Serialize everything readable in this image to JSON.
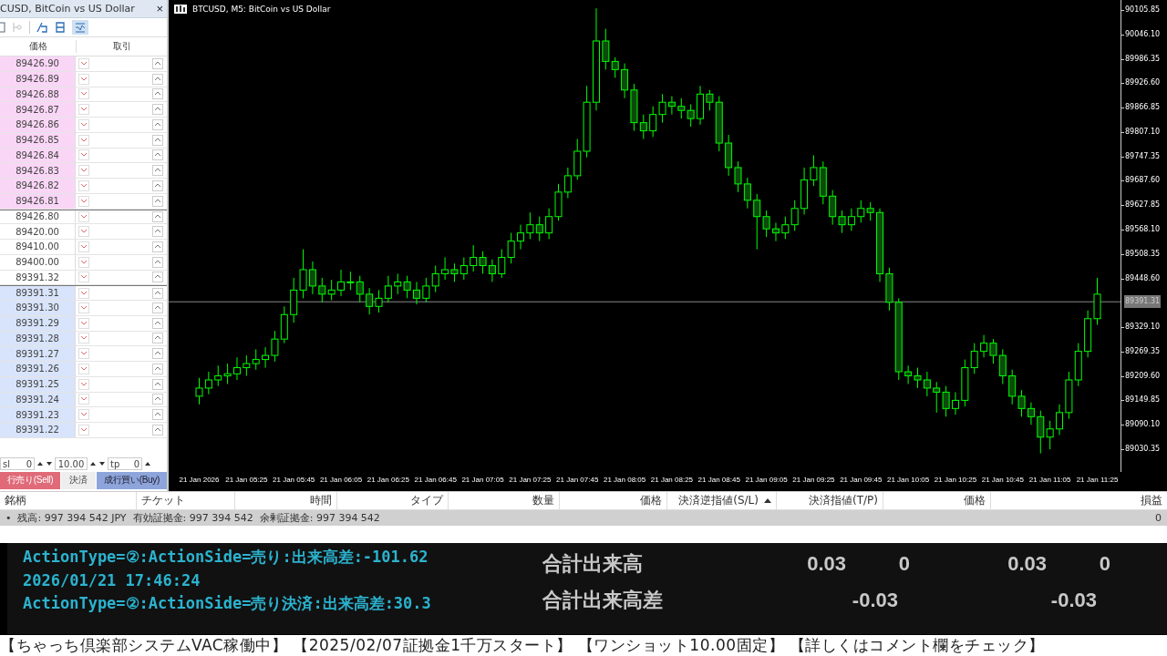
{
  "panel": {
    "title": "CUSD, BitCoin vs US Dollar",
    "close": "×",
    "headers": [
      "価格",
      "取引"
    ],
    "rows": [
      {
        "price": "89426.90",
        "kind": "sell"
      },
      {
        "price": "89426.89",
        "kind": "sell"
      },
      {
        "price": "89426.88",
        "kind": "sell"
      },
      {
        "price": "89426.87",
        "kind": "sell"
      },
      {
        "price": "89426.86",
        "kind": "sell"
      },
      {
        "price": "89426.85",
        "kind": "sell"
      },
      {
        "price": "89426.84",
        "kind": "sell"
      },
      {
        "price": "89426.83",
        "kind": "sell"
      },
      {
        "price": "89426.82",
        "kind": "sell"
      },
      {
        "price": "89426.81",
        "kind": "sell"
      },
      {
        "price": "89426.80",
        "kind": "plain"
      },
      {
        "price": "89420.00",
        "kind": "plain"
      },
      {
        "price": "89410.00",
        "kind": "plain"
      },
      {
        "price": "89400.00",
        "kind": "plain"
      },
      {
        "price": "89391.32",
        "kind": "plain"
      },
      {
        "price": "89391.31",
        "kind": "buy"
      },
      {
        "price": "89391.30",
        "kind": "buy"
      },
      {
        "price": "89391.29",
        "kind": "buy"
      },
      {
        "price": "89391.28",
        "kind": "buy"
      },
      {
        "price": "89391.27",
        "kind": "buy"
      },
      {
        "price": "89391.26",
        "kind": "buy"
      },
      {
        "price": "89391.25",
        "kind": "buy"
      },
      {
        "price": "89391.24",
        "kind": "buy"
      },
      {
        "price": "89391.23",
        "kind": "buy"
      },
      {
        "price": "89391.22",
        "kind": "buy"
      }
    ],
    "sl_label": "sl",
    "sl_value": "0",
    "volume": "10.00",
    "tp_label": "tp",
    "tp_value": "0",
    "sell_button": "行売り(Sell)",
    "close_button": "決済",
    "buy_button": "成行買い(Buy)"
  },
  "chart": {
    "title": "BTCUSD, M5: BitCoin vs US Dollar",
    "chart_data": {
      "type": "candlestick",
      "categories": [
        "21 Jan 2026",
        null,
        null,
        null,
        null,
        "21 Jan 05:25",
        null,
        null,
        null,
        null,
        "21 Jan 05:45",
        null,
        null,
        null,
        null,
        "21 Jan 06:05",
        null,
        null,
        null,
        null,
        "21 Jan 06:25",
        null,
        null,
        null,
        null,
        "21 Jan 06:45",
        null,
        null,
        null,
        null,
        "21 Jan 07:05",
        null,
        null,
        null,
        null,
        "21 Jan 07:25",
        null,
        null,
        null,
        null,
        "21 Jan 07:45",
        null,
        null,
        null,
        null,
        "21 Jan 08:05",
        null,
        null,
        null,
        null,
        "21 Jan 08:25",
        null,
        null,
        null,
        null,
        "21 Jan 08:45",
        null,
        null,
        null,
        null,
        "21 Jan 09:05",
        null,
        null,
        null,
        null,
        "21 Jan 09:25",
        null,
        null,
        null,
        null,
        "21 Jan 09:45",
        null,
        null,
        null,
        null,
        "21 Jan 10:05",
        null,
        null,
        null,
        null,
        "21 Jan 10:25",
        null,
        null,
        null,
        null,
        "21 Jan 10:45",
        null,
        null,
        null,
        null,
        "21 Jan 11:05",
        null,
        null,
        null,
        null,
        "21 Jan 11:25"
      ],
      "ohlc": [
        [
          89160,
          89205,
          89140,
          89180
        ],
        [
          89180,
          89220,
          89165,
          89200
        ],
        [
          89200,
          89235,
          89185,
          89210
        ],
        [
          89210,
          89240,
          89190,
          89215
        ],
        [
          89215,
          89255,
          89200,
          89230
        ],
        [
          89230,
          89260,
          89210,
          89240
        ],
        [
          89240,
          89275,
          89225,
          89250
        ],
        [
          89250,
          89280,
          89230,
          89260
        ],
        [
          89260,
          89320,
          89245,
          89300
        ],
        [
          89300,
          89380,
          89290,
          89360
        ],
        [
          89360,
          89450,
          89340,
          89420
        ],
        [
          89420,
          89520,
          89400,
          89470
        ],
        [
          89470,
          89490,
          89410,
          89430
        ],
        [
          89430,
          89450,
          89390,
          89410
        ],
        [
          89410,
          89445,
          89395,
          89420
        ],
        [
          89420,
          89470,
          89405,
          89440
        ],
        [
          89440,
          89465,
          89420,
          89440
        ],
        [
          89440,
          89455,
          89390,
          89410
        ],
        [
          89410,
          89425,
          89360,
          89380
        ],
        [
          89380,
          89420,
          89365,
          89400
        ],
        [
          89400,
          89455,
          89390,
          89430
        ],
        [
          89430,
          89460,
          89410,
          89440
        ],
        [
          89440,
          89455,
          89400,
          89420
        ],
        [
          89420,
          89440,
          89385,
          89400
        ],
        [
          89400,
          89450,
          89390,
          89430
        ],
        [
          89430,
          89480,
          89415,
          89460
        ],
        [
          89460,
          89500,
          89445,
          89470
        ],
        [
          89470,
          89485,
          89440,
          89460
        ],
        [
          89460,
          89500,
          89445,
          89480
        ],
        [
          89480,
          89530,
          89465,
          89500
        ],
        [
          89500,
          89515,
          89460,
          89480
        ],
        [
          89480,
          89495,
          89440,
          89460
        ],
        [
          89460,
          89520,
          89450,
          89500
        ],
        [
          89500,
          89560,
          89485,
          89540
        ],
        [
          89540,
          89580,
          89520,
          89560
        ],
        [
          89560,
          89610,
          89545,
          89580
        ],
        [
          89580,
          89600,
          89540,
          89560
        ],
        [
          89560,
          89620,
          89545,
          89600
        ],
        [
          89600,
          89680,
          89590,
          89660
        ],
        [
          89660,
          89720,
          89645,
          89700
        ],
        [
          89700,
          89790,
          89690,
          89760
        ],
        [
          89760,
          89920,
          89745,
          89880
        ],
        [
          89880,
          90110,
          89860,
          90030
        ],
        [
          90030,
          90060,
          89960,
          89980
        ],
        [
          89980,
          89990,
          89940,
          89960
        ],
        [
          89960,
          89975,
          89890,
          89910
        ],
        [
          89910,
          89925,
          89810,
          89830
        ],
        [
          89830,
          89850,
          89790,
          89810
        ],
        [
          89810,
          89870,
          89795,
          89850
        ],
        [
          89850,
          89900,
          89830,
          89880
        ],
        [
          89880,
          89895,
          89850,
          89870
        ],
        [
          89870,
          89890,
          89840,
          89860
        ],
        [
          89860,
          89875,
          89820,
          89840
        ],
        [
          89840,
          89920,
          89825,
          89900
        ],
        [
          89900,
          89910,
          89860,
          89880
        ],
        [
          89880,
          89895,
          89760,
          89780
        ],
        [
          89780,
          89800,
          89700,
          89720
        ],
        [
          89720,
          89735,
          89660,
          89680
        ],
        [
          89680,
          89695,
          89620,
          89640
        ],
        [
          89640,
          89655,
          89520,
          89600
        ],
        [
          89600,
          89615,
          89550,
          89570
        ],
        [
          89570,
          89585,
          89540,
          89560
        ],
        [
          89560,
          89600,
          89545,
          89580
        ],
        [
          89580,
          89640,
          89565,
          89620
        ],
        [
          89620,
          89720,
          89605,
          89690
        ],
        [
          89690,
          89750,
          89675,
          89720
        ],
        [
          89720,
          89735,
          89630,
          89650
        ],
        [
          89650,
          89665,
          89580,
          89600
        ],
        [
          89600,
          89615,
          89560,
          89580
        ],
        [
          89580,
          89620,
          89565,
          89600
        ],
        [
          89600,
          89640,
          89585,
          89620
        ],
        [
          89620,
          89635,
          89590,
          89610
        ],
        [
          89610,
          89620,
          89440,
          89460
        ],
        [
          89460,
          89475,
          89370,
          89390
        ],
        [
          89390,
          89400,
          89200,
          89220
        ],
        [
          89220,
          89235,
          89190,
          89210
        ],
        [
          89210,
          89230,
          89180,
          89200
        ],
        [
          89200,
          89220,
          89160,
          89180
        ],
        [
          89180,
          89195,
          89120,
          89170
        ],
        [
          89170,
          89185,
          89110,
          89130
        ],
        [
          89130,
          89170,
          89115,
          89150
        ],
        [
          89150,
          89250,
          89135,
          89230
        ],
        [
          89230,
          89290,
          89215,
          89270
        ],
        [
          89270,
          89310,
          89255,
          89290
        ],
        [
          89290,
          89300,
          89240,
          89260
        ],
        [
          89260,
          89275,
          89190,
          89210
        ],
        [
          89210,
          89225,
          89140,
          89160
        ],
        [
          89160,
          89175,
          89110,
          89130
        ],
        [
          89130,
          89145,
          89090,
          89110
        ],
        [
          89110,
          89125,
          89020,
          89060
        ],
        [
          89060,
          89100,
          89030,
          89080
        ],
        [
          89080,
          89140,
          89065,
          89120
        ],
        [
          89120,
          89220,
          89105,
          89200
        ],
        [
          89200,
          89290,
          89185,
          89270
        ],
        [
          89270,
          89370,
          89255,
          89350
        ],
        [
          89350,
          89450,
          89335,
          89410
        ]
      ],
      "ylim": [
        88974.6,
        90130.4
      ],
      "ref_lines": [
        {
          "axis": "y",
          "value": 89391.31,
          "label": "89391.31"
        }
      ],
      "yticks": [
        {
          "value": 90105.85,
          "label": "90105.85"
        },
        {
          "value": 90046.1,
          "label": "90046.10"
        },
        {
          "value": 89986.35,
          "label": "89986.35"
        },
        {
          "value": 89926.6,
          "label": "89926.60"
        },
        {
          "value": 89866.85,
          "label": "89866.85"
        },
        {
          "value": 89807.1,
          "label": "89807.10"
        },
        {
          "value": 89747.35,
          "label": "89747.35"
        },
        {
          "value": 89687.6,
          "label": "89687.60"
        },
        {
          "value": 89627.85,
          "label": "89627.85"
        },
        {
          "value": 89568.1,
          "label": "89568.10"
        },
        {
          "value": 89508.35,
          "label": "89508.35"
        },
        {
          "value": 89448.6,
          "label": "89448.60"
        },
        {
          "value": 89329.1,
          "label": "89329.10"
        },
        {
          "value": 89269.35,
          "label": "89269.35"
        },
        {
          "value": 89209.6,
          "label": "89209.60"
        },
        {
          "value": 89149.85,
          "label": "89149.85"
        },
        {
          "value": 89090.1,
          "label": "89090.10"
        },
        {
          "value": 89030.35,
          "label": "89030.35"
        }
      ]
    }
  },
  "positions": {
    "columns": [
      {
        "label": "銘柄",
        "sorted": false
      },
      {
        "label": "チケット",
        "sorted": false
      },
      {
        "label": "時間",
        "sorted": false
      },
      {
        "label": "タイプ",
        "sorted": false
      },
      {
        "label": "数量",
        "sorted": false
      },
      {
        "label": "価格",
        "sorted": false
      },
      {
        "label": "決済逆指値(S/L)",
        "sorted": true
      },
      {
        "label": "決済指値(T/P)",
        "sorted": false
      },
      {
        "label": "価格",
        "sorted": false
      },
      {
        "label": "損益",
        "sorted": false
      }
    ],
    "balance": "•  残高: 997 394 542 JPY  有効証拠金: 997 394 542  余剰証拠金: 997 394 542",
    "profit": "0"
  },
  "log": {
    "lines": [
      "ActionType=②:ActionSide=売り:出来高差:-101.62",
      "2026/01/21 17:46:24",
      "ActionType=②:ActionSide=売り決済:出来高差:30.3"
    ],
    "summary": [
      {
        "label": "合計出来高",
        "values": [
          "0.03",
          "0",
          "0.03",
          "0"
        ]
      },
      {
        "label": "合計出来高差",
        "values": [
          "-0.03",
          "-0.03"
        ]
      }
    ]
  },
  "ticker": "【ちゃっち倶楽部システムVAC稼働中】 【2025/02/07証拠金1千万スタート】 【ワンショット10.00固定】 【詳しくはコメント欄をチェック】"
}
